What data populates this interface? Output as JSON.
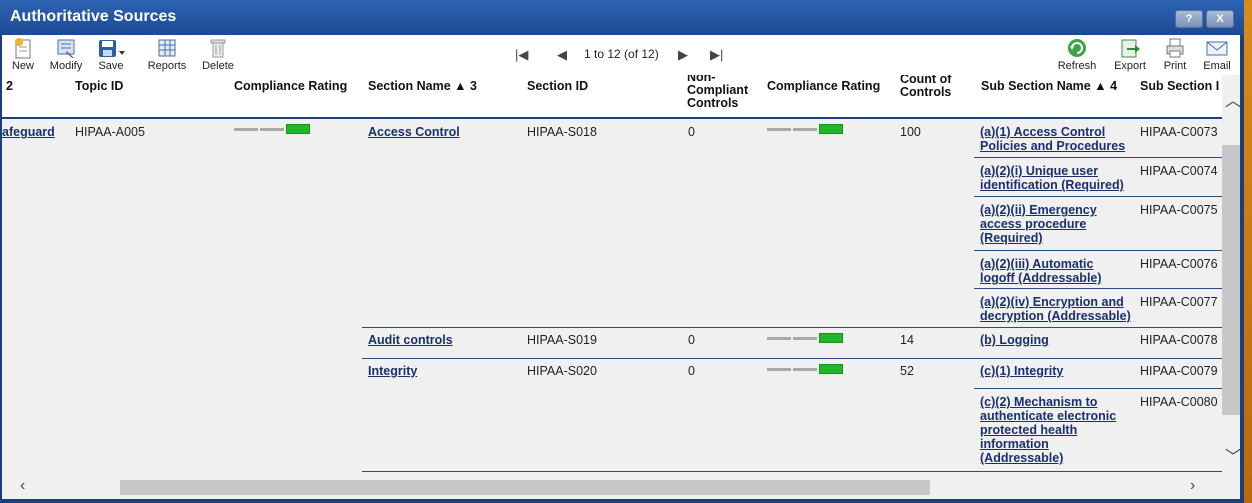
{
  "window": {
    "title": "Authoritative Sources",
    "help_label": "?",
    "close_label": "X"
  },
  "toolbar": {
    "new": "New",
    "modify": "Modify",
    "save": "Save",
    "reports": "Reports",
    "delete": "Delete",
    "refresh": "Refresh",
    "export": "Export",
    "print": "Print",
    "email": "Email"
  },
  "pager": {
    "text": "1 to 12 (of 12)"
  },
  "columns": {
    "c0": "2",
    "topic_id": "Topic ID",
    "rating1": "Compliance Rating",
    "section_name": "Section Name ▲ 3",
    "section_id": "Section ID",
    "noncompliant": [
      "Non-",
      "Compliant",
      "Controls"
    ],
    "rating2": "Compliance Rating",
    "count": [
      "Count of",
      "Controls"
    ],
    "sub_section_name": "Sub Section Name ▲ 4",
    "sub_section_id": "Sub Section I"
  },
  "topic": {
    "name_fragment": "afeguard",
    "id": "HIPAA-A005"
  },
  "sections": [
    {
      "name": "Access Control",
      "id": "HIPAA-S018",
      "noncompliant": "0",
      "count": "100"
    },
    {
      "name": "Audit controls",
      "id": "HIPAA-S019",
      "noncompliant": "0",
      "count": "14"
    },
    {
      "name": "Integrity",
      "id": "HIPAA-S020",
      "noncompliant": "0",
      "count": "52"
    }
  ],
  "subsections": [
    {
      "name": [
        "(a)(1) Access Control",
        "Policies and Procedures"
      ],
      "id": "HIPAA-C0073"
    },
    {
      "name": [
        "(a)(2)(i) Unique user",
        "identification (Required)"
      ],
      "id": "HIPAA-C0074"
    },
    {
      "name": [
        "(a)(2)(ii) Emergency",
        "access procedure",
        "(Required)"
      ],
      "id": "HIPAA-C0075"
    },
    {
      "name": [
        "(a)(2)(iii) Automatic",
        "logoff (Addressable)"
      ],
      "id": "HIPAA-C0076"
    },
    {
      "name": [
        "(a)(2)(iv) Encryption and",
        "decryption (Addressable)"
      ],
      "id": "HIPAA-C0077"
    },
    {
      "name": [
        "(b) Logging"
      ],
      "id": "HIPAA-C0078"
    },
    {
      "name": [
        "(c)(1) Integrity"
      ],
      "id": "HIPAA-C0079"
    },
    {
      "name": [
        "(c)(2) Mechanism to",
        "authenticate electronic",
        "protected health",
        "information",
        "(Addressable)"
      ],
      "id": "HIPAA-C0080"
    }
  ],
  "colors": {
    "accent": "#1b4a93",
    "rating_green": "#22b62b",
    "link": "#1b2f6b"
  }
}
